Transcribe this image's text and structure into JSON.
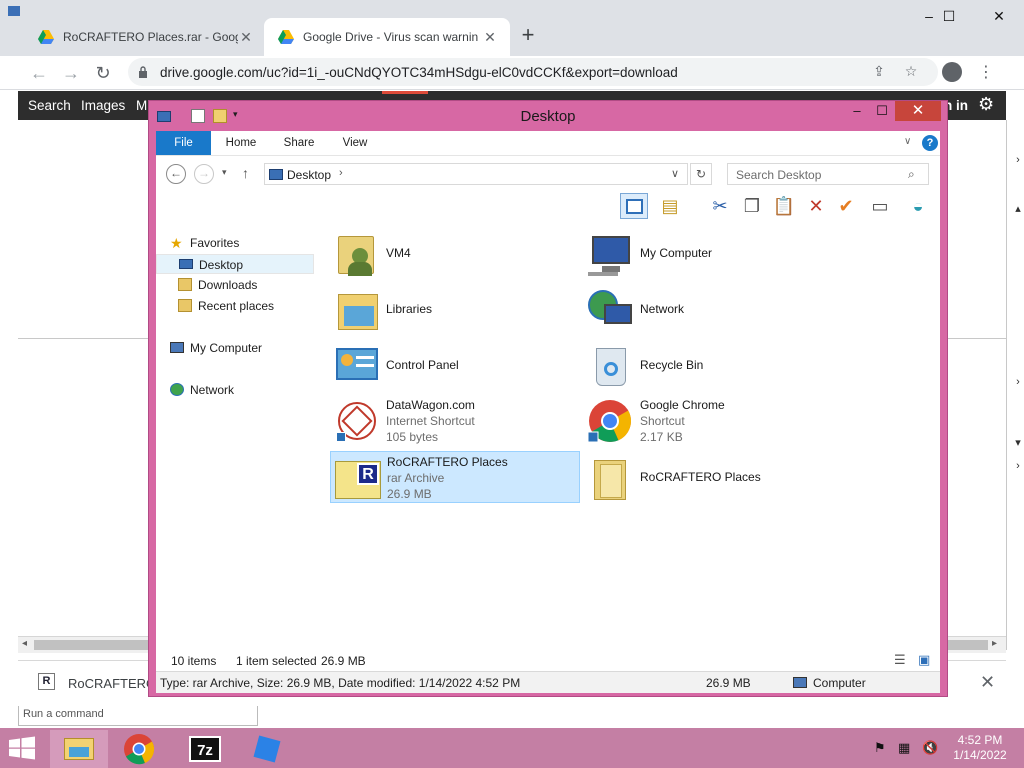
{
  "browser": {
    "tabs": [
      {
        "title": "RoCRAFTERO Places.rar - Google",
        "active": false
      },
      {
        "title": "Google Drive - Virus scan warnin",
        "active": true
      }
    ],
    "url": "drive.google.com/uc?id=1i_-ouCNdQYOTC34mHSdgu-elC0vdCCKf&export=download",
    "new_tab": "+",
    "controls": {
      "minimize": "–",
      "maximize": "☐",
      "close": "✕"
    }
  },
  "page": {
    "bar_links": [
      "Search",
      "Images",
      "M"
    ],
    "signin": "n in"
  },
  "download_shelf": {
    "item_name": "RoCRAFTERO",
    "item_icon_letter": "R",
    "close": "✕"
  },
  "run_command": "Run a command",
  "explorer": {
    "title": "Desktop",
    "ribbon_tabs": [
      "File",
      "Home",
      "Share",
      "View"
    ],
    "help": "?",
    "breadcrumb": "Desktop",
    "search_placeholder": "Search Desktop",
    "nav": {
      "favorites": "Favorites",
      "favorites_items": [
        "Desktop",
        "Downloads",
        "Recent places"
      ],
      "selected": "Desktop",
      "my_computer": "My Computer",
      "network": "Network"
    },
    "items": [
      {
        "name": "VM4",
        "line2": "",
        "line3": "",
        "icon": "user-folder-icon"
      },
      {
        "name": "My Computer",
        "line2": "",
        "line3": "",
        "icon": "computer-icon"
      },
      {
        "name": "Libraries",
        "line2": "",
        "line3": "",
        "icon": "libraries-icon"
      },
      {
        "name": "Network",
        "line2": "",
        "line3": "",
        "icon": "network-icon"
      },
      {
        "name": "Control Panel",
        "line2": "",
        "line3": "",
        "icon": "control-panel-icon"
      },
      {
        "name": "Recycle Bin",
        "line2": "",
        "line3": "",
        "icon": "recycle-bin-icon"
      },
      {
        "name": "DataWagon.com",
        "line2": "Internet Shortcut",
        "line3": "105 bytes",
        "icon": "internet-shortcut-icon"
      },
      {
        "name": "Google Chrome",
        "line2": "Shortcut",
        "line3": "2.17 KB",
        "icon": "chrome-icon"
      },
      {
        "name": "RoCRAFTERO Places",
        "line2": "rar Archive",
        "line3": "26.9 MB",
        "icon": "rar-archive-icon",
        "selected": true
      },
      {
        "name": "RoCRAFTERO Places",
        "line2": "",
        "line3": "",
        "icon": "folder-icon"
      }
    ],
    "status": {
      "count": "10 items",
      "selection": "1 item selected",
      "size": "26.9 MB"
    },
    "details": {
      "info": "Type: rar Archive, Size: 26.9 MB, Date modified: 1/14/2022 4:52 PM",
      "size": "26.9 MB",
      "location": "Computer"
    }
  },
  "taskbar": {
    "apps": [
      "file-explorer-icon",
      "chrome-icon",
      "7zip-icon",
      "roblox-icon"
    ],
    "time": "4:52 PM",
    "date": "1/14/2022"
  },
  "colors": {
    "window_frame": "#d768a4",
    "taskbar": "#c47fa4",
    "ribbon_file": "#1979ca",
    "selection": "#cce8ff"
  }
}
